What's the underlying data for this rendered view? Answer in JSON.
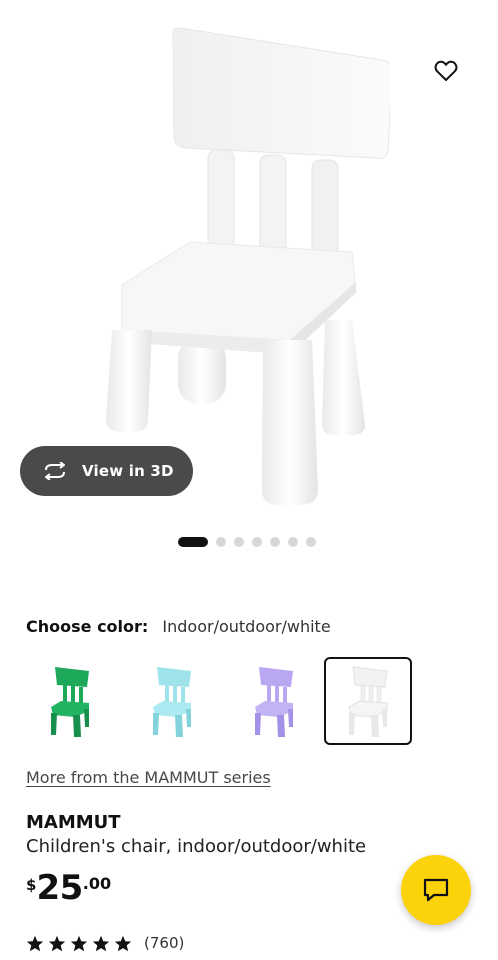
{
  "gallery": {
    "view_3d_label": "View in 3D",
    "dot_count": 7,
    "active_dot": 0
  },
  "color": {
    "label": "Choose color:",
    "selected_value": "Indoor/outdoor/white",
    "swatches": [
      {
        "name": "green",
        "hex": "#1ea85a"
      },
      {
        "name": "light-turquoise",
        "hex": "#9fe3ea"
      },
      {
        "name": "lilac",
        "hex": "#b9a7f2"
      },
      {
        "name": "white",
        "hex": "#f4f4f4",
        "selected": true
      }
    ]
  },
  "series_link": "More from the MAMMUT series",
  "product": {
    "name": "MAMMUT",
    "description": "Children's chair, indoor/outdoor/white",
    "price": {
      "currency": "$",
      "integer": "25",
      "decimal": ".00"
    }
  },
  "rating": {
    "stars": 5,
    "count": "(760)"
  },
  "colors": {
    "brand_yellow": "#fcd20a",
    "pill_bg": "#4a4a4a"
  }
}
